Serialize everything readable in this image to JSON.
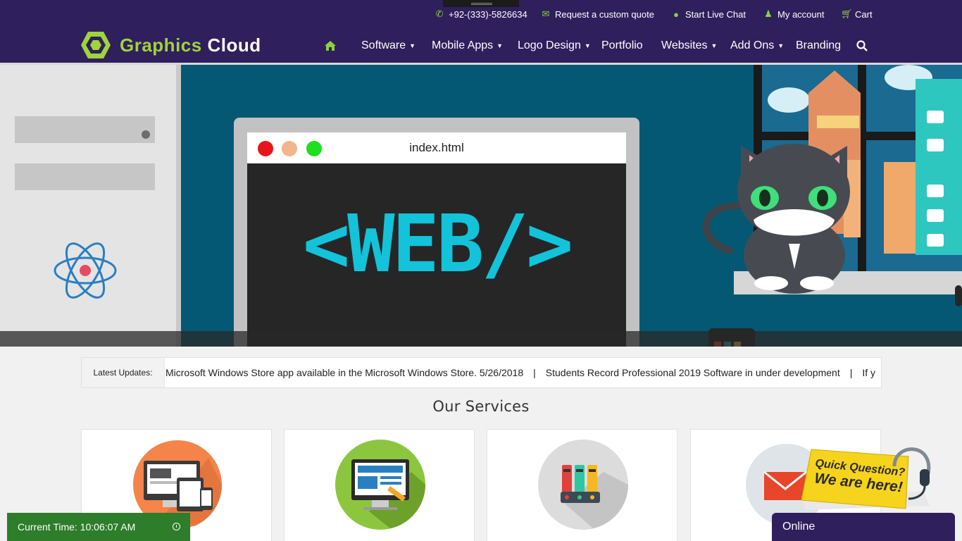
{
  "topbar": {
    "phone": "+92-(333)-5826634",
    "quote": "Request a custom quote",
    "chat": "Start Live Chat",
    "account": "My account",
    "cart": "Cart"
  },
  "brand": {
    "word1": "Graphics",
    "word2": "Cloud"
  },
  "nav": {
    "software": "Software",
    "mobile_apps": "Mobile Apps",
    "logo_design": "Logo Design",
    "portfolio": "Portfolio",
    "websites": "Websites",
    "add_ons": "Add Ons",
    "branding": "Branding"
  },
  "hero": {
    "window_title": "index.html",
    "headline": "<WEB/>"
  },
  "updates": {
    "label": "Latest Updates:",
    "items": [
      "Microsoft Windows Store app available in the Microsoft Windows Store. 5/26/2018",
      "Students Record Professional 2019 Software in under development",
      "If y"
    ],
    "separator": "|"
  },
  "services": {
    "title": "Our Services"
  },
  "widgets": {
    "time": "Current Time: 10:06:07 AM",
    "chat_status": "Online",
    "quick_q_line1": "Quick Question?",
    "quick_q_line2": "We are here!"
  },
  "colors": {
    "header_bg": "#2f1f5c",
    "accent_green": "#8bd23b",
    "hero_bg": "#055874",
    "time_widget_bg": "#2d7d2a"
  },
  "icons": {
    "phone": "phone-icon",
    "quote": "envelope-icon",
    "chat": "chat-bubble-icon",
    "account": "user-icon",
    "cart": "cart-icon",
    "home": "home-icon",
    "search": "search-icon"
  }
}
